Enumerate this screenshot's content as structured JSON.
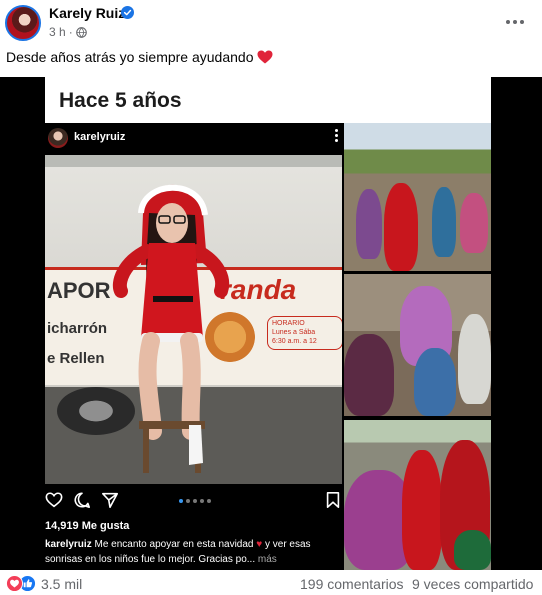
{
  "post": {
    "author": "Karely Ruiz",
    "time": "3 h",
    "caption": "Desde años atrás yo siempre ayudando",
    "caption_emoji": "red-heart"
  },
  "media": {
    "title": "Hace 5 años",
    "instagram": {
      "username": "karelyruiz",
      "sign_left": "APOR",
      "sign_brand": "randa",
      "sign_line2": "icharrón",
      "sign_line3": "e Rellen",
      "sign_hours": "HORARIO\nLunes a Sába\n6:30 a.m. a 12",
      "likes": "14,919 Me gusta",
      "caption_user": "karelyruiz",
      "caption_text": "Me encanto apoyar en esta navidad",
      "caption_text2": "y ver esas sonrisas en los niños fue lo mejor. Gracias po...",
      "caption_more": "más"
    }
  },
  "footer": {
    "reactions_count": "3.5 mil",
    "comments": "199 comentarios",
    "shares": "9 veces compartido"
  },
  "colors": {
    "brand_blue": "#1b74e4",
    "like_blue": "#1877f2",
    "love_red": "#f33e58",
    "text_secondary": "#65676b"
  }
}
